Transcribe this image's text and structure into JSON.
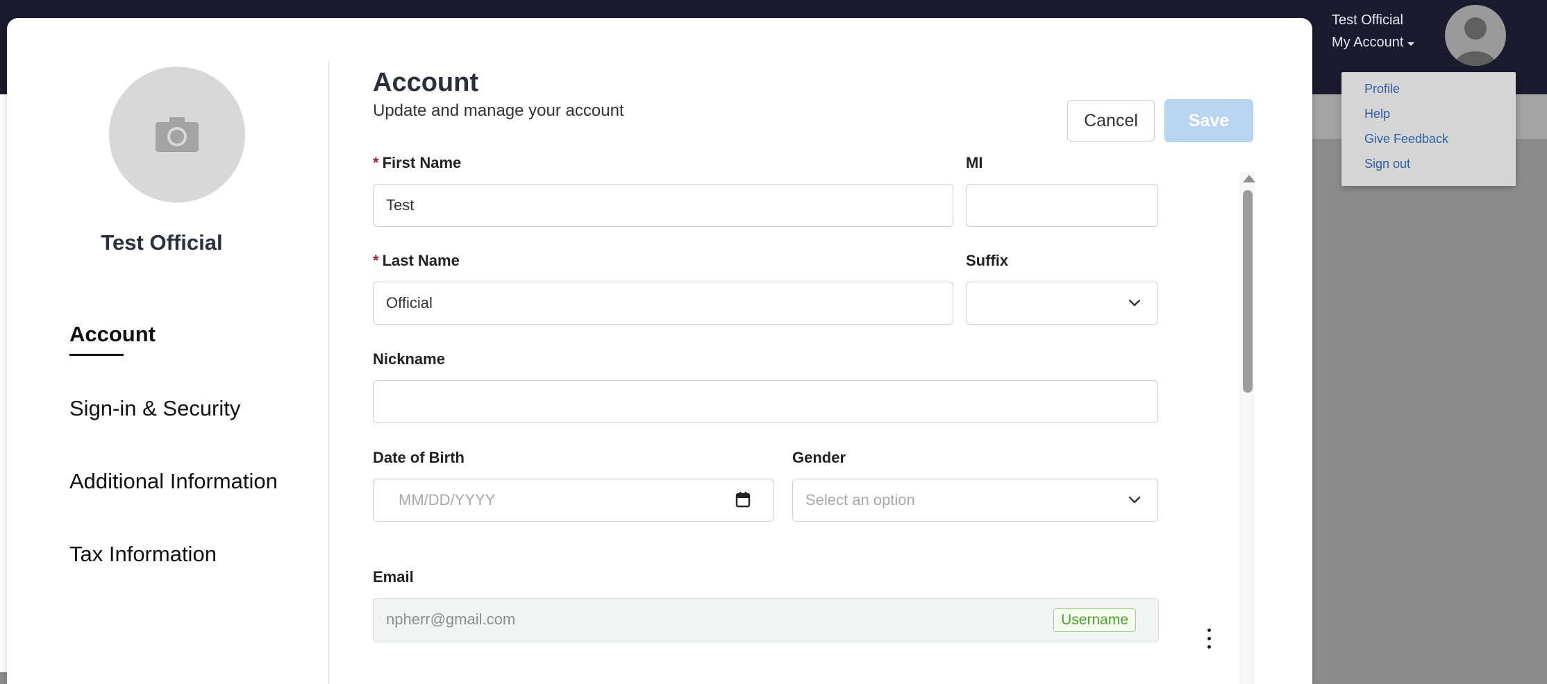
{
  "topbar": {
    "user_name": "Test Official",
    "account_menu_label": "My Account",
    "menu_items": [
      "Profile",
      "Help",
      "Give Feedback",
      "Sign out"
    ]
  },
  "sidebar": {
    "user_name": "Test Official",
    "items": [
      {
        "label": "Account",
        "active": true
      },
      {
        "label": "Sign-in & Security",
        "active": false
      },
      {
        "label": "Additional Information",
        "active": false
      },
      {
        "label": "Tax Information",
        "active": false
      }
    ]
  },
  "main": {
    "title": "Account",
    "subtitle": "Update and manage your account",
    "cancel_label": "Cancel",
    "save_label": "Save",
    "fields": {
      "first_name": {
        "label": "First Name",
        "required_mark": "*",
        "value": "Test"
      },
      "mi": {
        "label": "MI",
        "value": ""
      },
      "last_name": {
        "label": "Last Name",
        "required_mark": "*",
        "value": "Official"
      },
      "suffix": {
        "label": "Suffix",
        "value": ""
      },
      "nickname": {
        "label": "Nickname",
        "value": ""
      },
      "dob": {
        "label": "Date of Birth",
        "placeholder": "MM/DD/YYYY"
      },
      "gender": {
        "label": "Gender",
        "placeholder": "Select an option"
      },
      "email": {
        "label": "Email",
        "value": "npherr@gmail.com",
        "badge": "Username"
      }
    }
  },
  "colors": {
    "topbar": "#1c1a2e",
    "save_disabled": "#b9d4ee",
    "required": "#a01f2f",
    "link": "#2e5fa6",
    "badge_green": "#4fa032"
  },
  "icons": [
    "camera-icon",
    "user-avatar-icon",
    "caret-down-icon",
    "chevron-down-icon",
    "calendar-icon",
    "more-vertical-icon"
  ]
}
